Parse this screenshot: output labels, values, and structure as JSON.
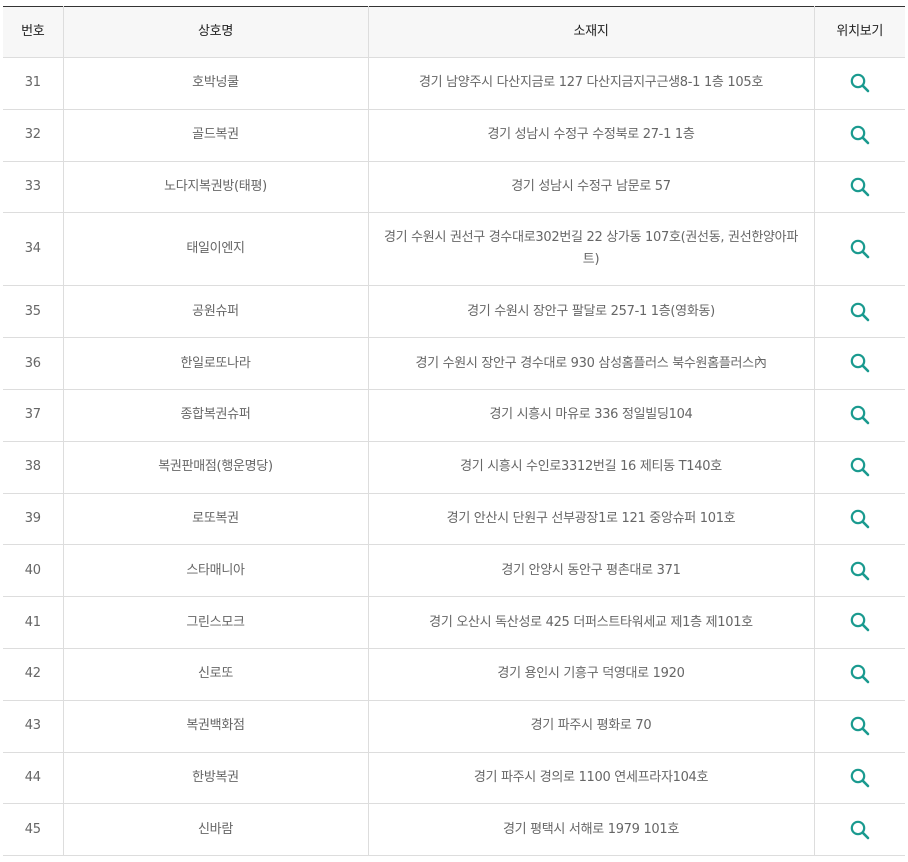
{
  "table": {
    "headers": {
      "number": "번호",
      "name": "상호명",
      "address": "소재지",
      "location": "위치보기"
    },
    "icon_color": "#1a9a8f",
    "location_icon": "search-icon",
    "rows": [
      {
        "number": "31",
        "name": "호박넝쿨",
        "address": "경기 남양주시 다산지금로 127 다산지금지구근생8-1 1층 105호"
      },
      {
        "number": "32",
        "name": "골드복권",
        "address": "경기 성남시 수정구 수정북로 27-1 1층"
      },
      {
        "number": "33",
        "name": "노다지복권방(태평)",
        "address": "경기 성남시 수정구 남문로 57"
      },
      {
        "number": "34",
        "name": "태일이엔지",
        "address": "경기 수원시 권선구 경수대로302번길 22 상가동 107호(권선동, 권선한양아파트)"
      },
      {
        "number": "35",
        "name": "공원슈퍼",
        "address": "경기 수원시 장안구 팔달로 257-1 1층(영화동)"
      },
      {
        "number": "36",
        "name": "한일로또나라",
        "address": "경기 수원시 장안구 경수대로 930 삼성홈플러스 북수원홈플러스內"
      },
      {
        "number": "37",
        "name": "종합복권슈퍼",
        "address": "경기 시흥시 마유로 336 정일빌딩104"
      },
      {
        "number": "38",
        "name": "복권판매점(행운명당)",
        "address": "경기 시흥시 수인로3312번길 16 제티동 T140호"
      },
      {
        "number": "39",
        "name": "로또복권",
        "address": "경기 안산시 단원구 선부광장1로 121 중앙슈퍼 101호"
      },
      {
        "number": "40",
        "name": "스타매니아",
        "address": "경기 안양시 동안구 평촌대로 371"
      },
      {
        "number": "41",
        "name": "그린스모크",
        "address": "경기 오산시 독산성로 425 더퍼스트타워세교 제1층 제101호"
      },
      {
        "number": "42",
        "name": "신로또",
        "address": "경기 용인시 기흥구 덕영대로 1920"
      },
      {
        "number": "43",
        "name": "복권백화점",
        "address": "경기 파주시 평화로 70"
      },
      {
        "number": "44",
        "name": "한방복권",
        "address": "경기 파주시 경의로 1100 연세프라자104호"
      },
      {
        "number": "45",
        "name": "신바람",
        "address": "경기 평택시 서해로 1979 101호"
      }
    ]
  }
}
